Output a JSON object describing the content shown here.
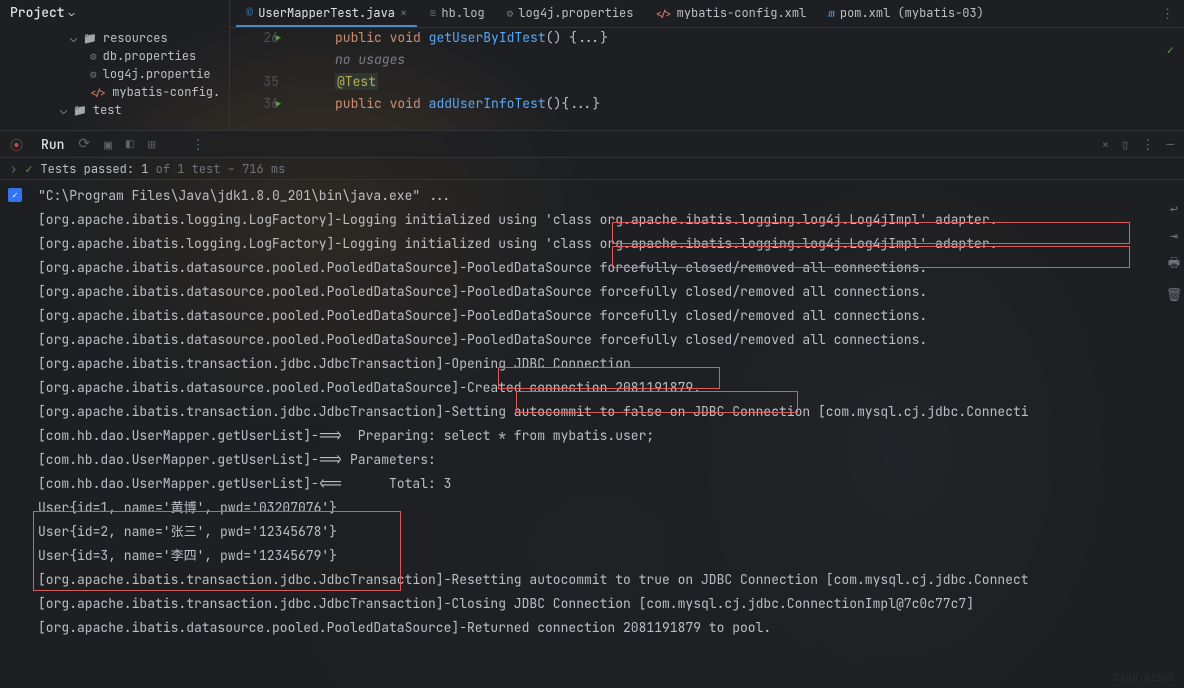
{
  "project": {
    "label": "Project"
  },
  "tree": {
    "resources": "resources",
    "db_props": "db.properties",
    "log4j_props": "log4j.propertie",
    "mybatis_cfg": "mybatis-config.",
    "test": "test"
  },
  "tabs": {
    "usermapper": "UserMapperTest.java",
    "hblog": "hb.log",
    "log4j": "log4j.properties",
    "mybatis": "mybatis-config.xml",
    "pom": "pom.xml (mybatis-03)"
  },
  "gutter": {
    "l26": "26",
    "l35": "35",
    "l36": "36"
  },
  "code": {
    "public": "public",
    "void": "void",
    "getUserByIdTest": "getUserByIdTest",
    "addUserInfoTest": "addUserInfoTest",
    "parens_fold": "() {...}",
    "parens_fold2": "(){...}",
    "no_usages": "no usages",
    "anno_test": "@Test"
  },
  "run": {
    "label": "Run"
  },
  "tests": {
    "passed": "Tests passed: 1",
    "of": " of 1 test",
    "dash": " – ",
    "time": "716 ms"
  },
  "console": {
    "l0": "\"C:\\Program Files\\Java\\jdk1.8.0_201\\bin\\java.exe\" ...",
    "l1a": "[org.apache.ibatis.logging.LogFactory]-Logging initialized using ",
    "l1b": "'class org.apache.ibatis.logging.log4j.Log4jImpl' adapter.",
    "l2a": "[org.apache.ibatis.logging.LogFactory]-Logging initialized using ",
    "l2b": "'class org.apache.ibatis.logging.log4j.Log4jImpl' adapter.",
    "l3": "[org.apache.ibatis.datasource.pooled.PooledDataSource]-PooledDataSource forcefully closed/removed all connections.",
    "l4": "[org.apache.ibatis.datasource.pooled.PooledDataSource]-PooledDataSource forcefully closed/removed all connections.",
    "l5": "[org.apache.ibatis.datasource.pooled.PooledDataSource]-PooledDataSource forcefully closed/removed all connections.",
    "l6": "[org.apache.ibatis.datasource.pooled.PooledDataSource]-PooledDataSource forcefully closed/removed all connections.",
    "l7a": "[org.apache.ibatis.transaction.jdbc.JdbcTransaction]",
    "l7b": "-Opening JDBC Connection",
    "l8a": "[org.apache.ibatis.datasource.pooled.PooledDataSource]",
    "l8b": "-Created connection 2081191879.",
    "l9": "[org.apache.ibatis.transaction.jdbc.JdbcTransaction]-Setting autocommit to false on JDBC Connection [com.mysql.cj.jdbc.Connecti",
    "l10": "[com.hb.dao.UserMapper.getUserList]-==>  Preparing: select * from mybatis.user;",
    "l11": "[com.hb.dao.UserMapper.getUserList]-==> Parameters: ",
    "l12": "[com.hb.dao.UserMapper.getUserList]-<==      Total: 3",
    "l13": "User{id=1, name='黄博', pwd='03207076'}",
    "l14": "User{id=2, name='张三', pwd='12345678'}",
    "l15": "User{id=3, name='李四', pwd='12345679'}",
    "l16": "[org.apache.ibatis.transaction.jdbc.JdbcTransaction]-Resetting autocommit to true on JDBC Connection [com.mysql.cj.jdbc.Connect",
    "l17": "[org.apache.ibatis.transaction.jdbc.JdbcTransaction]-Closing JDBC Connection [com.mysql.cj.jdbc.ConnectionImpl@7c0c77c7]",
    "l18": "[org.apache.ibatis.datasource.pooled.PooledDataSource]-Returned connection 2081191879 to pool."
  }
}
